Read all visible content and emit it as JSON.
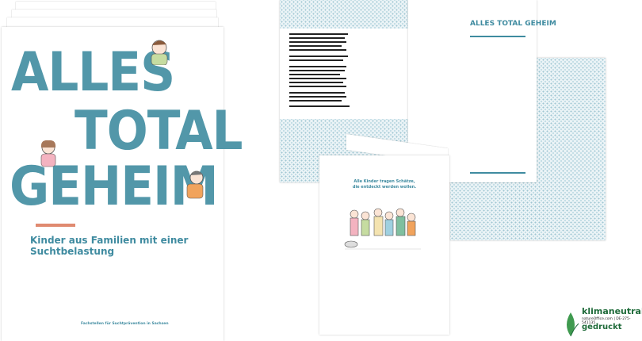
{
  "brochure": {
    "title_line1": "ALLES",
    "title_line2": "TOTAL",
    "title_line3": "GEHEIM",
    "subtitle": "Kinder aus Familien mit einer Suchtbelastung",
    "footer": "Fachstellen für Suchtprävention in Sachsen"
  },
  "spread": {
    "title": "ALLES TOTAL GEHEIM"
  },
  "booklet": {
    "line1": "Alle Kinder tragen Schätze,",
    "line2": "die entdeckt werden wollen."
  },
  "logo": {
    "title": "klimaneutral",
    "subtitle": "natureOffice.com | DE-275-541135",
    "printed": "gedruckt"
  },
  "colors": {
    "accent": "#5297a9",
    "bar": "#e08a70",
    "logo_green": "#1f6b3a"
  }
}
